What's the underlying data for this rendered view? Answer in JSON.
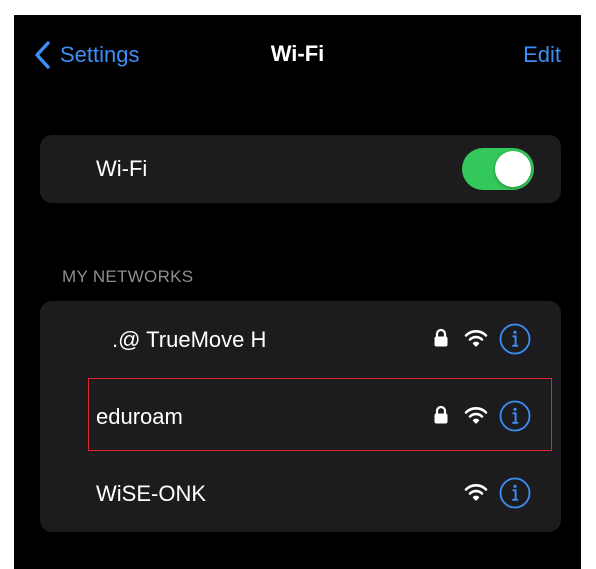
{
  "nav": {
    "back_label": "Settings",
    "title": "Wi-Fi",
    "edit_label": "Edit"
  },
  "wifi_toggle": {
    "label": "Wi-Fi",
    "on": true
  },
  "section_header": "MY NETWORKS",
  "networks": [
    {
      "name": ".@ TrueMove H",
      "secured": true,
      "signal_icon": "wifi-icon",
      "info_icon": "info-icon"
    },
    {
      "name": "eduroam",
      "secured": true,
      "signal_icon": "wifi-icon",
      "info_icon": "info-icon",
      "highlighted": true
    },
    {
      "name": "WiSE-ONK",
      "secured": false,
      "signal_icon": "wifi-icon",
      "info_icon": "info-icon"
    }
  ],
  "colors": {
    "accent": "#3b8ff7",
    "toggle_on": "#34c759",
    "card_bg": "#1c1c1e",
    "background": "#000000",
    "highlight": "#e0242b"
  }
}
